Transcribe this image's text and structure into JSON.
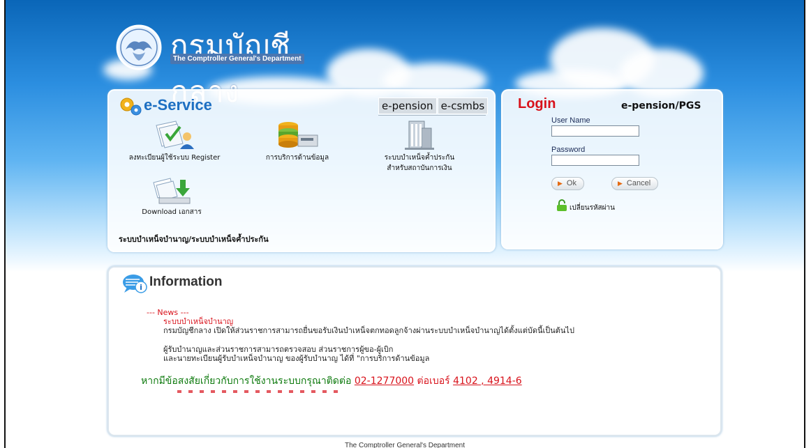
{
  "header": {
    "logo_title": "กรมบัญชีกลาง",
    "logo_subtitle": "The Comptroller General's Department"
  },
  "eservice": {
    "title": "e-Service",
    "tabs": [
      {
        "label": "e-pension"
      },
      {
        "label": "e-csmbs"
      }
    ],
    "services": [
      {
        "label": "ลงทะเบียนผู้ใช้ระบบ Register",
        "icon": "register-icon"
      },
      {
        "label": "การบริการด้านข้อมูล",
        "icon": "database-icon"
      },
      {
        "label_line1": "ระบบบำเหน็จค้ำประกัน",
        "label_line2": "สำหรับสถาบันการเงิน",
        "icon": "building-icon"
      },
      {
        "label": "Download เอกสาร",
        "icon": "download-icon"
      }
    ],
    "footer": "ระบบบำเหน็จบำนาญ/ระบบบำเหน็จค้ำประกัน"
  },
  "login": {
    "title": "Login",
    "system": "e-pension/PGS",
    "username_label": "User Name",
    "username_value": "",
    "password_label": "Password",
    "password_value": "",
    "ok_label": "Ok",
    "cancel_label": "Cancel",
    "change_password": "เปลี่ยนรหัสผ่าน"
  },
  "info": {
    "title": "Information",
    "news_header": "--- News ---",
    "news_sub": "ระบบบำเหน็จบำนาญ",
    "news_line1": "กรมบัญชีกลาง เปิดให้ส่วนราชการสามารถยื่นขอรับเงินบำเหน็จตกทอดลูกจ้างผ่านระบบบำเหน็จบำนาญได้ตั้งแต่บัดนี้เป็นต้นไป",
    "news_line2": "ผู้รับบำนาญและส่วนราชการสามารถตรวจสอบ ส่วนราชการผู้ขอ-ผู้เบิก",
    "news_line3": "และนายทะเบียนผู้รับบำเหน็จบำนาญ ของผู้รับบำนาญ ได้ที่ \"การบริการด้านข้อมูล",
    "contact_text": "หากมีข้อสงสัยเกี่ยวกับการใช้งานระบบกรุณาติดต่อ",
    "contact_phone": "02-1277000",
    "contact_ext_label": "ต่อเบอร์",
    "contact_ext": "4102 , 4914-6"
  },
  "footer": "The Comptroller General's Department",
  "colors": {
    "brand_blue": "#1d6fc2",
    "login_red": "#d8121b",
    "contact_green": "#0e7a0e"
  }
}
